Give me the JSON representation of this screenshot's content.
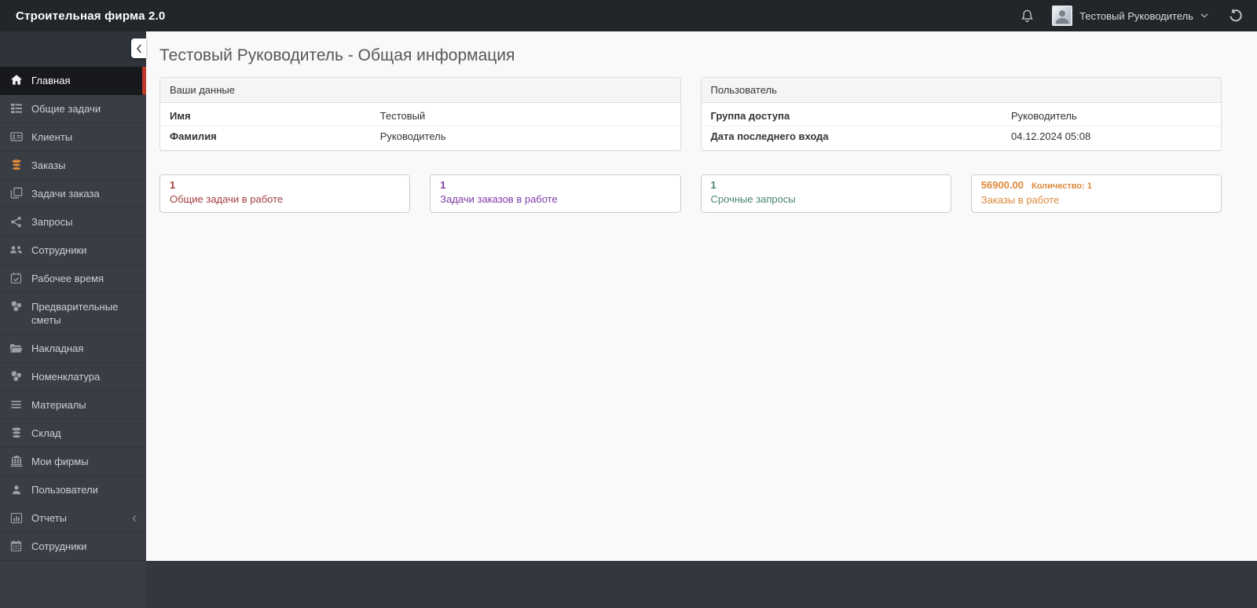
{
  "topbar": {
    "brand": "Строительная фирма 2.0",
    "user_name": "Тестовый Руководитель",
    "icons": [
      "bell-icon",
      "avatar",
      "chevron-down-icon",
      "rotate-left-icon"
    ]
  },
  "colors": {
    "accent_red": "#c0392b",
    "orders_icon_orange": "#e0883c"
  },
  "sidebar": {
    "items": [
      {
        "label": "Главная",
        "icon": "home-icon",
        "active": true
      },
      {
        "label": "Общие задачи",
        "icon": "tasks-icon"
      },
      {
        "label": "Клиенты",
        "icon": "id-card-icon"
      },
      {
        "label": "Заказы",
        "icon": "database-icon",
        "icon_color": "#e0883c"
      },
      {
        "label": "Задачи заказа",
        "icon": "clone-icon"
      },
      {
        "label": "Запросы",
        "icon": "share-icon"
      },
      {
        "label": "Сотрудники",
        "icon": "users-icon"
      },
      {
        "label": "Рабочее время",
        "icon": "calendar-check-icon"
      },
      {
        "label": "Предварительные сметы",
        "icon": "coins-icon"
      },
      {
        "label": "Накладная",
        "icon": "folder-open-icon"
      },
      {
        "label": "Номенклатура",
        "icon": "coins-icon"
      },
      {
        "label": "Материалы",
        "icon": "list-icon"
      },
      {
        "label": "Склад",
        "icon": "stack-icon"
      },
      {
        "label": "Мои фирмы",
        "icon": "bank-icon"
      },
      {
        "label": "Пользователи",
        "icon": "user-icon"
      },
      {
        "label": "Отчеты",
        "icon": "chart-bar-icon",
        "has_submenu": true
      },
      {
        "label": "Сотрудники",
        "icon": "calendar-icon"
      }
    ]
  },
  "main": {
    "page_title": "Тестовый Руководитель - Общая информация",
    "panels": [
      {
        "title": "Ваши данные",
        "rows": [
          {
            "label": "Имя",
            "value": "Тестовый"
          },
          {
            "label": "Фамилия",
            "value": "Руководитель"
          }
        ]
      },
      {
        "title": "Пользователь",
        "rows": [
          {
            "label": "Группа доступа",
            "value": "Руководитель"
          },
          {
            "label": "Дата последнего входа",
            "value": "04.12.2024 05:08"
          }
        ]
      }
    ],
    "stat_cards": [
      {
        "value": "1",
        "label": "Общие задачи в работе",
        "color": "#a1403e"
      },
      {
        "value": "1",
        "label": "Задачи заказов в работе",
        "color": "#7d3ca3"
      },
      {
        "value": "1",
        "label": "Срочные запросы",
        "color": "#4d8374"
      },
      {
        "value": "56900.00",
        "qty_label": "Количество: 1",
        "label": "Заказы в работе",
        "color": "#dd8a3b"
      }
    ]
  }
}
